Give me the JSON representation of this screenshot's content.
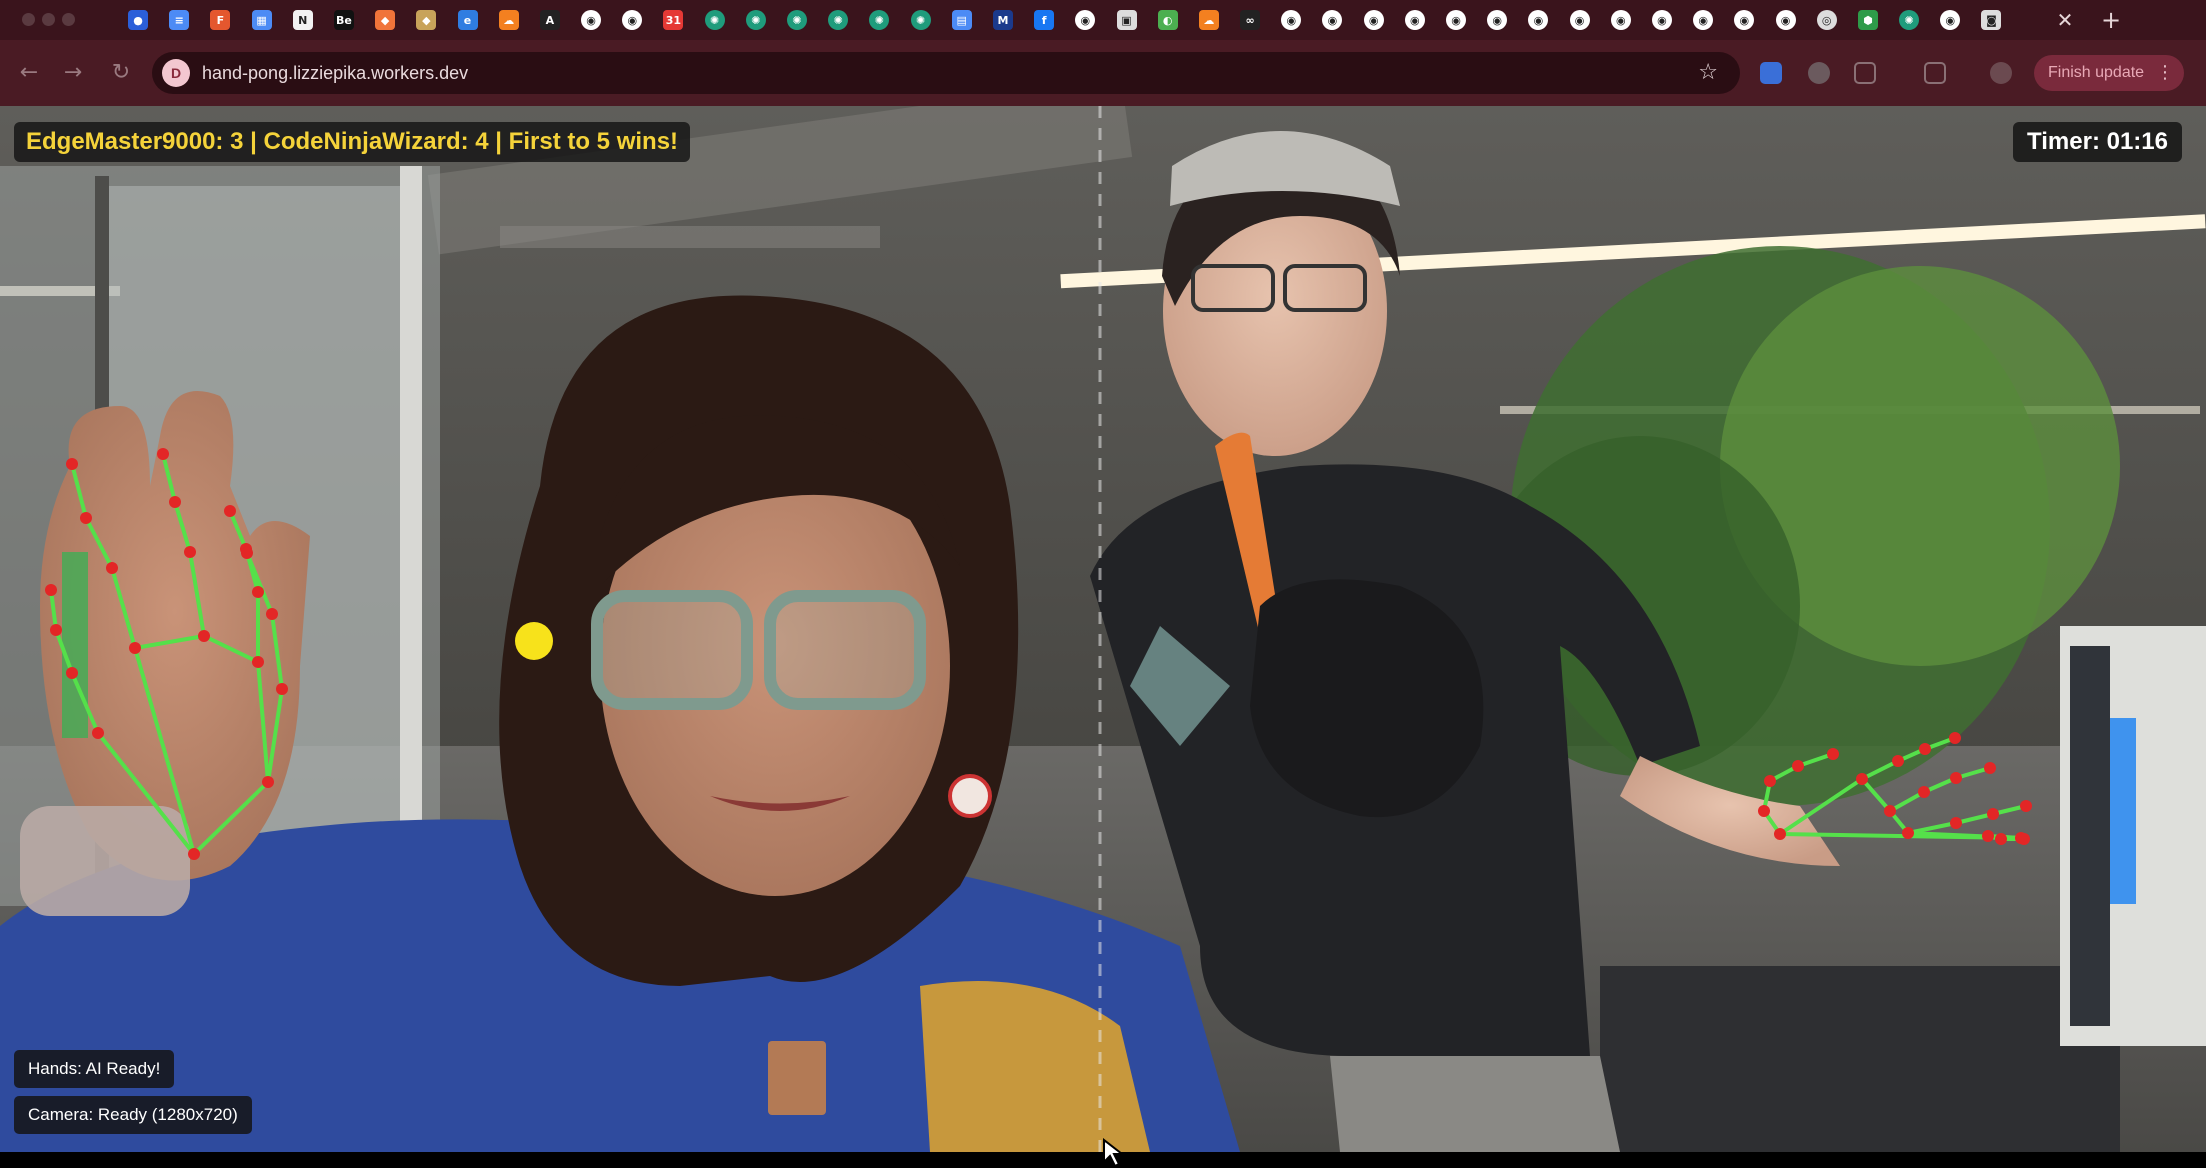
{
  "browser": {
    "url": "hand-pong.lizziepika.workers.dev",
    "site_icon_letter": "D",
    "update_label": "Finish update",
    "tab_close_glyph": "✕",
    "new_tab_glyph": "+",
    "back_glyph": "←",
    "forward_glyph": "→",
    "reload_glyph": "↻",
    "star_glyph": "☆",
    "menu_glyph": "⋮",
    "tab_icons": [
      {
        "name": "map-pin-icon",
        "bg": "#2b5fd9",
        "glyph": "●"
      },
      {
        "name": "docs-icon",
        "bg": "#4c8bf5",
        "glyph": "≡"
      },
      {
        "name": "figma-icon",
        "bg": "#e4572e",
        "glyph": "F"
      },
      {
        "name": "calendar-icon",
        "bg": "#4c8bf5",
        "glyph": "▦"
      },
      {
        "name": "notion-icon",
        "bg": "#f2f2f2",
        "glyph": "N"
      },
      {
        "name": "be-icon",
        "bg": "#111111",
        "glyph": "Be"
      },
      {
        "name": "brave-icon",
        "bg": "#f0743a",
        "glyph": "◆"
      },
      {
        "name": "shield-icon",
        "bg": "#c8a35a",
        "glyph": "◆"
      },
      {
        "name": "edge-icon",
        "bg": "#2f7de1",
        "glyph": "e"
      },
      {
        "name": "cloudflare-icon",
        "bg": "#f38020",
        "glyph": "☁"
      },
      {
        "name": "api-icon",
        "bg": "#222222",
        "glyph": "A"
      },
      {
        "name": "github-icon",
        "bg": "#ffffff",
        "glyph": "◉"
      },
      {
        "name": "github-icon",
        "bg": "#ffffff",
        "glyph": "◉"
      },
      {
        "name": "calendar-31-icon",
        "bg": "#e53935",
        "glyph": "31"
      },
      {
        "name": "openai-icon",
        "bg": "#1f9c7c",
        "glyph": "✺"
      },
      {
        "name": "openai-icon",
        "bg": "#1f9c7c",
        "glyph": "✺"
      },
      {
        "name": "openai-icon",
        "bg": "#1f9c7c",
        "glyph": "✺"
      },
      {
        "name": "openai-icon",
        "bg": "#1f9c7c",
        "glyph": "✺"
      },
      {
        "name": "openai-icon",
        "bg": "#1f9c7c",
        "glyph": "✺"
      },
      {
        "name": "openai-icon",
        "bg": "#1f9c7c",
        "glyph": "✺"
      },
      {
        "name": "doc-icon",
        "bg": "#4c8bf5",
        "glyph": "▤"
      },
      {
        "name": "mlb-icon",
        "bg": "#1b3a8c",
        "glyph": "M"
      },
      {
        "name": "facebook-icon",
        "bg": "#1877f2",
        "glyph": "f"
      },
      {
        "name": "github-icon",
        "bg": "#ffffff",
        "glyph": "◉"
      },
      {
        "name": "photo-icon",
        "bg": "#dddddd",
        "glyph": "▣"
      },
      {
        "name": "gemini-icon",
        "bg": "#4caf50",
        "glyph": "◐"
      },
      {
        "name": "cloudflare-icon",
        "bg": "#f38020",
        "glyph": "☁"
      },
      {
        "name": "hn-icon",
        "bg": "#222222",
        "glyph": "∞"
      },
      {
        "name": "github-icon",
        "bg": "#ffffff",
        "glyph": "◉"
      },
      {
        "name": "github-icon",
        "bg": "#ffffff",
        "glyph": "◉"
      },
      {
        "name": "github-icon",
        "bg": "#ffffff",
        "glyph": "◉"
      },
      {
        "name": "github-icon",
        "bg": "#ffffff",
        "glyph": "◉"
      },
      {
        "name": "github-icon",
        "bg": "#ffffff",
        "glyph": "◉"
      },
      {
        "name": "github-icon",
        "bg": "#ffffff",
        "glyph": "◉"
      },
      {
        "name": "github-icon",
        "bg": "#ffffff",
        "glyph": "◉"
      },
      {
        "name": "github-icon",
        "bg": "#ffffff",
        "glyph": "◉"
      },
      {
        "name": "github-icon",
        "bg": "#ffffff",
        "glyph": "◉"
      },
      {
        "name": "github-icon",
        "bg": "#ffffff",
        "glyph": "◉"
      },
      {
        "name": "github-icon",
        "bg": "#ffffff",
        "glyph": "◉"
      },
      {
        "name": "github-icon",
        "bg": "#ffffff",
        "glyph": "◉"
      },
      {
        "name": "github-icon",
        "bg": "#ffffff",
        "glyph": "◉"
      },
      {
        "name": "disk-icon",
        "bg": "#dddddd",
        "glyph": "◎"
      },
      {
        "name": "extension-icon",
        "bg": "#2e9b49",
        "glyph": "⬢"
      },
      {
        "name": "openai-icon",
        "bg": "#1f9c7c",
        "glyph": "✺"
      },
      {
        "name": "github-icon",
        "bg": "#ffffff",
        "glyph": "◉"
      },
      {
        "name": "camera-icon",
        "bg": "#dddddd",
        "glyph": "◙"
      }
    ]
  },
  "game": {
    "score_text": "EdgeMaster9000: 3 | CodeNinjaWizard: 4 | First to 5 wins!",
    "timer_text": "Timer: 01:16",
    "hands_status": "Hands: AI Ready!",
    "camera_status": "Camera: Ready (1280x720)",
    "colors": {
      "score_text": "#f5d33a",
      "ball": "#f7e21b",
      "left_paddle": "#3fae55",
      "right_paddle": "#2e8bf0",
      "hand_line": "#55e04a",
      "hand_point": "#e32626"
    }
  }
}
